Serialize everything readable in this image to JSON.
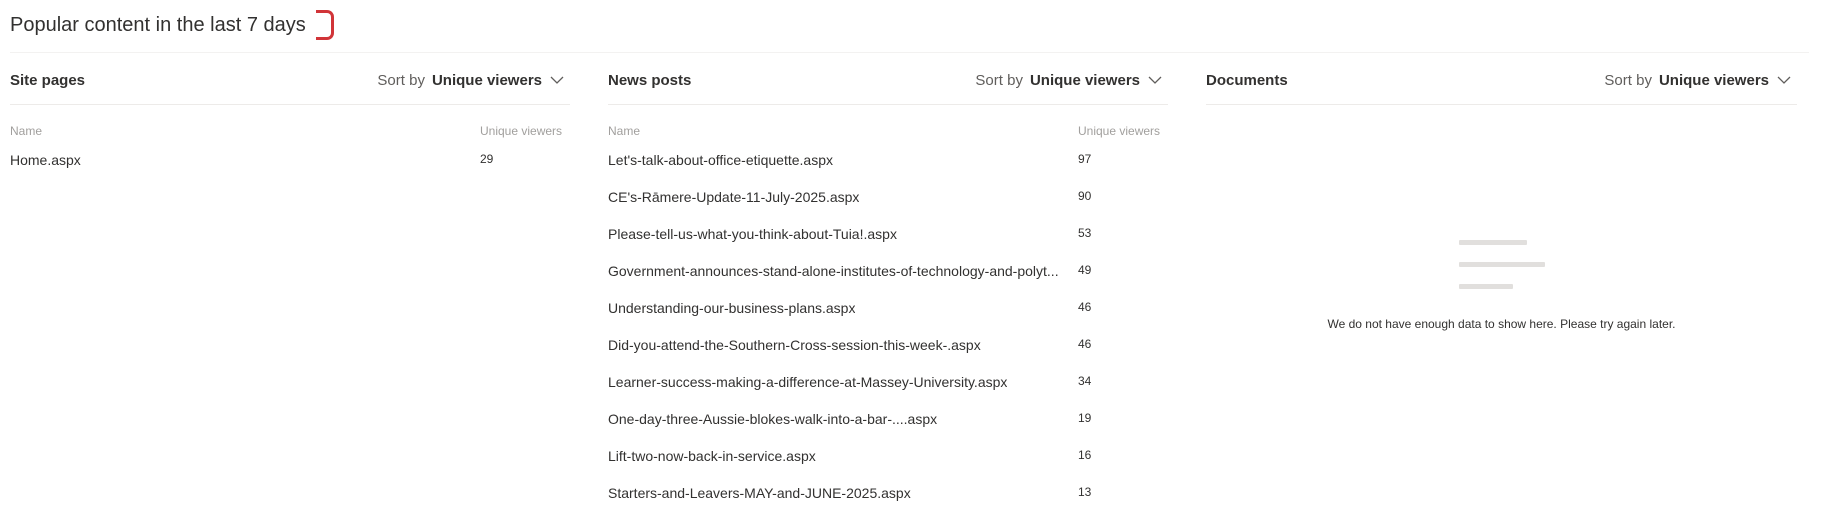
{
  "page": {
    "title": "Popular content in the last 7 days",
    "accent_color": "#d13438"
  },
  "sort_icon": "chevron-down-icon",
  "empty_icon": "empty-lines-icon",
  "site_pages": {
    "title": "Site pages",
    "sort_label": "Sort by",
    "sort_value": "Unique viewers",
    "col_name": "Name",
    "col_viewers": "Unique viewers",
    "rows": [
      {
        "name": "Home.aspx",
        "viewers": "29"
      }
    ]
  },
  "news_posts": {
    "title": "News posts",
    "sort_label": "Sort by",
    "sort_value": "Unique viewers",
    "col_name": "Name",
    "col_viewers": "Unique viewers",
    "rows": [
      {
        "name": "Let's-talk-about-office-etiquette.aspx",
        "viewers": "97"
      },
      {
        "name": "CE's-Rāmere-Update-11-July-2025.aspx",
        "viewers": "90"
      },
      {
        "name": "Please-tell-us-what-you-think-about-Tuia!.aspx",
        "viewers": "53"
      },
      {
        "name": "Government-announces-stand-alone-institutes-of-technology-and-polyt...",
        "viewers": "49"
      },
      {
        "name": "Understanding-our-business-plans.aspx",
        "viewers": "46"
      },
      {
        "name": "Did-you-attend-the-Southern-Cross-session-this-week-.aspx",
        "viewers": "46"
      },
      {
        "name": "Learner-success-making-a-difference-at-Massey-University.aspx",
        "viewers": "34"
      },
      {
        "name": "One-day-three-Aussie-blokes-walk-into-a-bar-....aspx",
        "viewers": "19"
      },
      {
        "name": "Lift-two-now-back-in-service.aspx",
        "viewers": "16"
      },
      {
        "name": "Starters-and-Leavers-MAY-and-JUNE-2025.aspx",
        "viewers": "13"
      }
    ]
  },
  "documents": {
    "title": "Documents",
    "sort_label": "Sort by",
    "sort_value": "Unique viewers",
    "empty_message": "We do not have enough data to show here. Please try again later."
  }
}
